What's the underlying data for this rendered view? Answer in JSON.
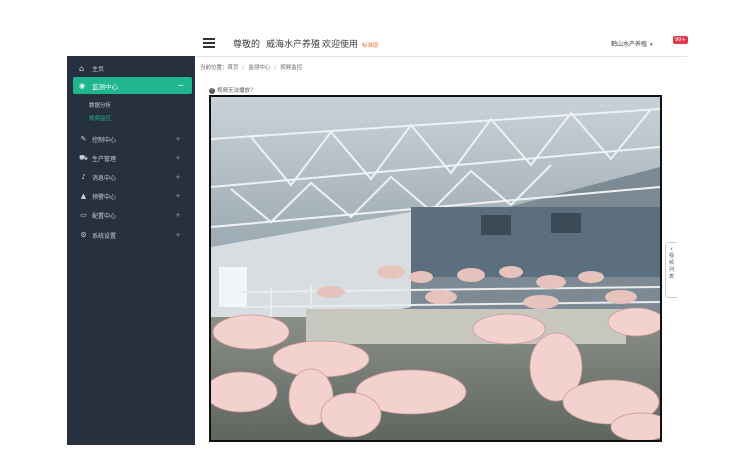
{
  "header": {
    "greeting": "尊敬的",
    "company": "威海水产养殖",
    "welcome": "欢迎使用",
    "tag": "标准版",
    "user_name": "鹤山水产养殖",
    "user_caret": "▾",
    "badge": "99+"
  },
  "sidebar": {
    "home": "主页",
    "active": {
      "label": "监测中心",
      "toggle": "−"
    },
    "sub_items": [
      "数据分析",
      "视频监控"
    ],
    "items": [
      {
        "label": "控制中心",
        "icon": "wrench-icon",
        "glyph": "✎"
      },
      {
        "label": "生产管理",
        "icon": "truck-icon",
        "glyph": "⛟"
      },
      {
        "label": "消息中心",
        "icon": "bell-icon",
        "glyph": "♪"
      },
      {
        "label": "预警中心",
        "icon": "alert-icon",
        "glyph": "▲"
      },
      {
        "label": "配置中心",
        "icon": "monitor-icon",
        "glyph": "▭"
      },
      {
        "label": "系统设置",
        "icon": "gear-icon",
        "glyph": "⚙"
      }
    ],
    "plus": "+"
  },
  "breadcrumb": {
    "prefix": "当前位置：",
    "items": [
      "首页",
      "监测中心",
      "视频监控"
    ]
  },
  "help_text": "视频无法播放？",
  "side_tab": {
    "arrow": "‹",
    "text": [
      "视",
      "频",
      "列",
      "表"
    ]
  },
  "colors": {
    "sidebar_bg": "#26303f",
    "accent": "#1fb58f",
    "badge": "#e5374a"
  }
}
